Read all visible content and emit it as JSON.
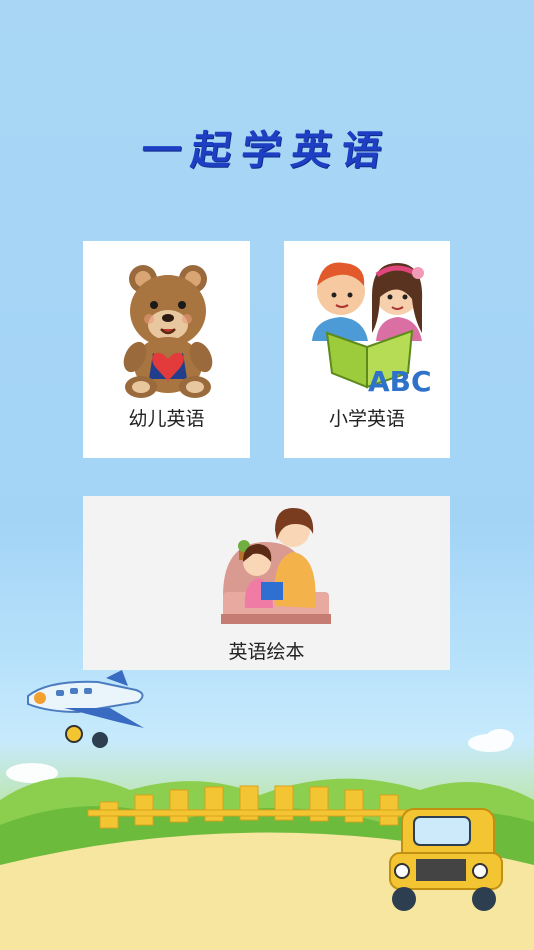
{
  "app": {
    "title": "一起学英语"
  },
  "menu": {
    "kids_english": {
      "label": "幼儿英语",
      "icon": "teddy-bear-icon"
    },
    "primary_english": {
      "label": "小学英语",
      "icon": "children-reading-abc-icon",
      "image_text": "ABC"
    },
    "picture_books": {
      "label": "英语绘本",
      "icon": "mother-reading-to-child-icon"
    }
  },
  "decor": {
    "top_left": "airplane-icon",
    "bottom_right": "toy-truck-icon",
    "colors": {
      "title": "#1d3fc4",
      "sky": "#a9d6f5",
      "ground": "#f6e5a2"
    }
  }
}
